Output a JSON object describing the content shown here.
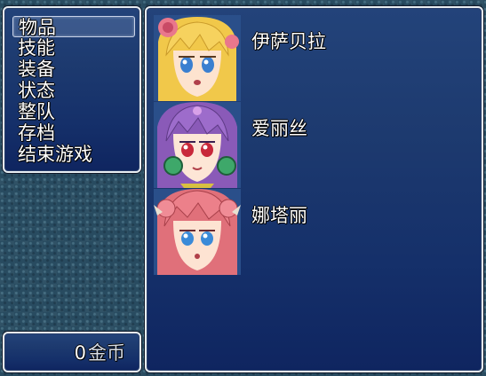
{
  "menu": {
    "commands": [
      {
        "label": "物品",
        "selected": true
      },
      {
        "label": "技能",
        "selected": false
      },
      {
        "label": "装备",
        "selected": false
      },
      {
        "label": "状态",
        "selected": false
      },
      {
        "label": "整队",
        "selected": false
      },
      {
        "label": "存档",
        "selected": false
      },
      {
        "label": "结束游戏",
        "selected": false
      }
    ]
  },
  "gold": {
    "amount": "0",
    "unit": "金币"
  },
  "party": [
    {
      "name": "伊萨贝拉",
      "portrait": "blonde-girl-portrait"
    },
    {
      "name": "爱丽丝",
      "portrait": "purple-hair-girl-portrait"
    },
    {
      "name": "娜塔丽",
      "portrait": "pink-hair-girl-portrait"
    }
  ],
  "colors": {
    "window_top": "#23437a",
    "window_bottom": "#0f2560",
    "window_border": "#e8eef2",
    "text": "#ffffff"
  }
}
